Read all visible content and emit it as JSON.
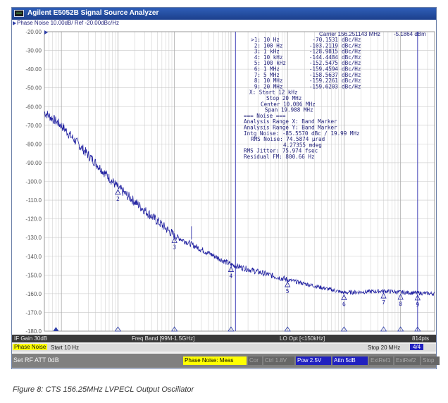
{
  "window": {
    "title": "Agilent E5052B Signal Source Analyzer"
  },
  "trace_header": "Phase Noise 10.00dB/ Ref -20.00dBc/Hz",
  "carrier_readout": {
    "carrier": "Carrier 156.251143 MHz",
    "power": "-5.1864 dBm"
  },
  "marker_table": {
    "rows": [
      {
        "id": ">1:",
        "freq": "10 Hz",
        "val": "-70.1531",
        "unit": "dBc/Hz"
      },
      {
        "id": "2:",
        "freq": "100 Hz",
        "val": "-103.2119",
        "unit": "dBc/Hz"
      },
      {
        "id": "3:",
        "freq": "1 kHz",
        "val": "-128.9815",
        "unit": "dBc/Hz"
      },
      {
        "id": "4:",
        "freq": "10 kHz",
        "val": "-144.4484",
        "unit": "dBc/Hz"
      },
      {
        "id": "5:",
        "freq": "100 kHz",
        "val": "-152.5475",
        "unit": "dBc/Hz"
      },
      {
        "id": "6:",
        "freq": "1 MHz",
        "val": "-159.4594",
        "unit": "dBc/Hz"
      },
      {
        "id": "7:",
        "freq": "5 MHz",
        "val": "-158.5637",
        "unit": "dBc/Hz"
      },
      {
        "id": "8:",
        "freq": "10 MHz",
        "val": "-159.2261",
        "unit": "dBc/Hz"
      },
      {
        "id": "9:",
        "freq": "20 MHz",
        "val": "-159.6203",
        "unit": "dBc/Hz"
      }
    ],
    "range": [
      "X: Start 12 kHz",
      "Stop 20 MHz",
      "Center 10.006 MHz",
      "Span 19.988 MHz"
    ],
    "noise": [
      "=== Noise ===",
      "Analysis Range X: Band Marker",
      "Analysis Range Y: Band Marker",
      "Intg Noise: -85.5570 dBc / 19.99 MHz",
      "RMS Noise: 74.5874 µrad",
      "4.27355 mdeg",
      "RMS Jitter: 75.974 fsec",
      "Residual FM: 800.66 Hz"
    ]
  },
  "chart_data": {
    "type": "line",
    "title": "",
    "xlabel": "",
    "ylabel": "",
    "x_scale": "log",
    "x_range_hz": [
      5,
      40000000
    ],
    "ylim": [
      -180,
      -20
    ],
    "y_ticks": [
      "-20.00",
      "-30.00",
      "-40.00",
      "-50.00",
      "-60.00",
      "-70.00",
      "-80.00",
      "-90.00",
      "-100.0",
      "-110.0",
      "-120.0",
      "-130.0",
      "-140.0",
      "-150.0",
      "-160.0",
      "-170.0",
      "-180.0"
    ],
    "grid": true,
    "series": [
      {
        "name": "",
        "x": [
          5,
          10,
          100,
          1000,
          10000,
          100000,
          1000000,
          5000000,
          10000000,
          20000000,
          40000000
        ],
        "y": [
          -63,
          -70.1531,
          -103.2119,
          -128.9815,
          -144.4484,
          -152.5475,
          -159.4594,
          -158.5637,
          -159.2261,
          -159.6203,
          -160
        ]
      }
    ],
    "markers": [
      {
        "label": "2",
        "x": 100,
        "y": -103.2119
      },
      {
        "label": "3",
        "x": 1000,
        "y": -128.9815
      },
      {
        "label": "4",
        "x": 10000,
        "y": -144.4484
      },
      {
        "label": "5",
        "x": 100000,
        "y": -152.5475
      },
      {
        "label": "6",
        "x": 1000000,
        "y": -159.4594
      },
      {
        "label": "7",
        "x": 5000000,
        "y": -158.5637
      },
      {
        "label": "8",
        "x": 10000000,
        "y": -159.2261
      },
      {
        "label": "9",
        "x": 20000000,
        "y": -159.6203
      }
    ],
    "band_marker_x_hz": [
      12000,
      20000000
    ]
  },
  "status1": {
    "if_gain": "IF Gain 30dB",
    "freq_band": "Freq Band [99M-1.5GHz]",
    "lo_opt": "LO Opt [<150kHz]",
    "points": "814pts"
  },
  "status2": {
    "measurement": "Phase Noise",
    "start": "Start 10 Hz",
    "stop": "Stop 20 MHz",
    "page": "4/4"
  },
  "softkeys": {
    "left": "Set RF ATT 0dB",
    "chips": [
      {
        "label": "Phase Noise: Meas",
        "fg": "#000000",
        "bg": "#ffff00"
      },
      {
        "label": "Cor",
        "fg": "#a8a8a8",
        "bg": "#666666"
      },
      {
        "label": "Ctrl  1.8V",
        "fg": "#a8a8a8",
        "bg": "#666666"
      },
      {
        "label": "Pow  2.5V",
        "fg": "#ffffff",
        "bg": "#2020c0"
      },
      {
        "label": "Attn 5dB",
        "fg": "#ffffff",
        "bg": "#2020c0"
      },
      {
        "label": "ExtRef1",
        "fg": "#a8a8a8",
        "bg": "#666666"
      },
      {
        "label": "ExtRef2",
        "fg": "#a8a8a8",
        "bg": "#666666"
      },
      {
        "label": "Stop",
        "fg": "#a8a8a8",
        "bg": "#666666"
      }
    ]
  },
  "caption": "Figure 8: CTS 156.25MHz LVPECL Output Oscillator",
  "colors": {
    "trace": "#2020a0",
    "grid": "#c8c8c8",
    "marker_line": "#3030b0"
  }
}
